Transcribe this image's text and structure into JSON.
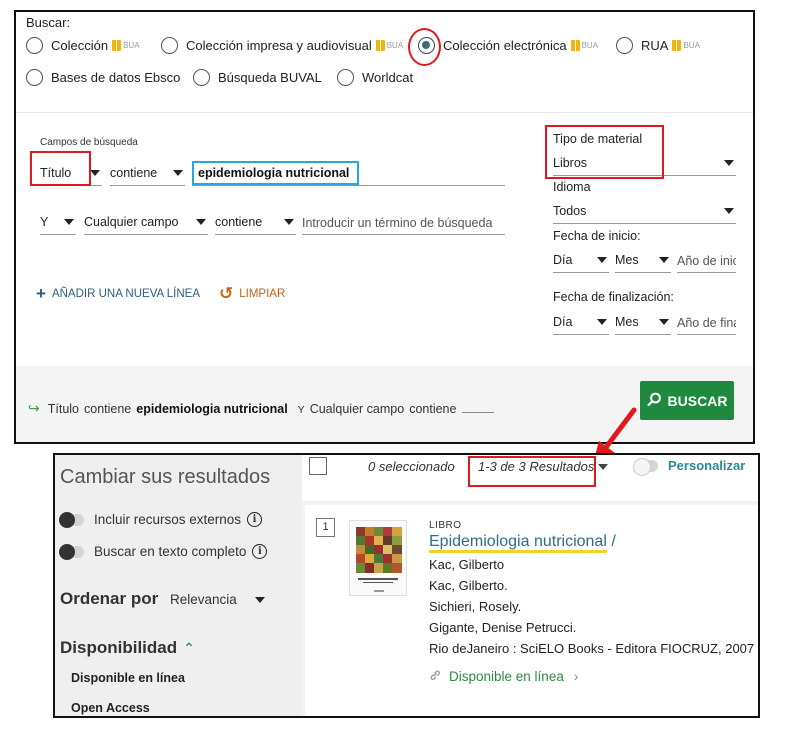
{
  "search": {
    "scope_label": "Buscar:",
    "scopes": [
      {
        "label": "Colección",
        "bua": true,
        "checked": false
      },
      {
        "label": "Colección impresa y audiovisual",
        "bua": true,
        "checked": false
      },
      {
        "label": "Colección electrónica",
        "bua": true,
        "checked": true
      },
      {
        "label": "RUA",
        "bua": true,
        "checked": false
      },
      {
        "label": "Bases de datos Ebsco",
        "bua": false,
        "checked": false
      },
      {
        "label": "Búsqueda BUVAL",
        "bua": false,
        "checked": false
      },
      {
        "label": "Worldcat",
        "bua": false,
        "checked": false
      }
    ],
    "bua_text": "BUA",
    "fields_label": "Campos de búsqueda",
    "row1": {
      "field": "Título",
      "operator": "contiene",
      "term": "epidemiologia nutricional"
    },
    "row2": {
      "boolean": "Y",
      "field": "Cualquier campo",
      "operator": "contiene",
      "placeholder": "Introducir un término de búsqueda"
    },
    "add_line": "AÑADIR UNA NUEVA LÍNEA",
    "clear": "LIMPIAR",
    "material_type_label": "Tipo de material",
    "material_type_value": "Libros",
    "language_label": "Idioma",
    "language_value": "Todos",
    "start_date_label": "Fecha de inicio:",
    "end_date_label": "Fecha de finalización:",
    "day": "Día",
    "month": "Mes",
    "year_start_placeholder": "Año de inic",
    "year_end_placeholder": "Año de fina",
    "summary": {
      "field1": "Título",
      "op1": "contiene",
      "term1": "epidemiologia nutricional",
      "bool": "Y",
      "field2": "Cualquier campo",
      "op2": "contiene"
    },
    "search_button": "BUSCAR"
  },
  "results": {
    "facets_title": "Cambiar sus resultados",
    "toggle_external": "Incluir recursos externos",
    "toggle_fulltext": "Buscar en texto completo",
    "sort_label": "Ordenar por",
    "sort_value": "Relevancia",
    "availability_title": "Disponibilidad",
    "availability_items": [
      "Disponible en línea",
      "Open Access"
    ],
    "selected_count": "0 seleccionado",
    "result_count": "1-3 de 3 Resultados",
    "personalize": "Personalizar",
    "items": [
      {
        "index": "1",
        "type": "LIBRO",
        "title": "Epidemiologia nutricional",
        "title_suffix": " /",
        "lines": [
          "Kac, Gilberto",
          "Kac, Gilberto.",
          "Sichieri, Rosely.",
          "Gigante, Denise Petrucci.",
          "Rio deJaneiro : SciELO Books - Editora FIOCRUZ, 2007"
        ],
        "availability": "Disponible en línea"
      }
    ]
  },
  "colors": {
    "highlight_red": "#e0191f",
    "highlight_blue": "#25a8e0",
    "button_green": "#1f8a3f",
    "link_blue": "#2b6e8a",
    "teal": "#2b8a8f"
  }
}
